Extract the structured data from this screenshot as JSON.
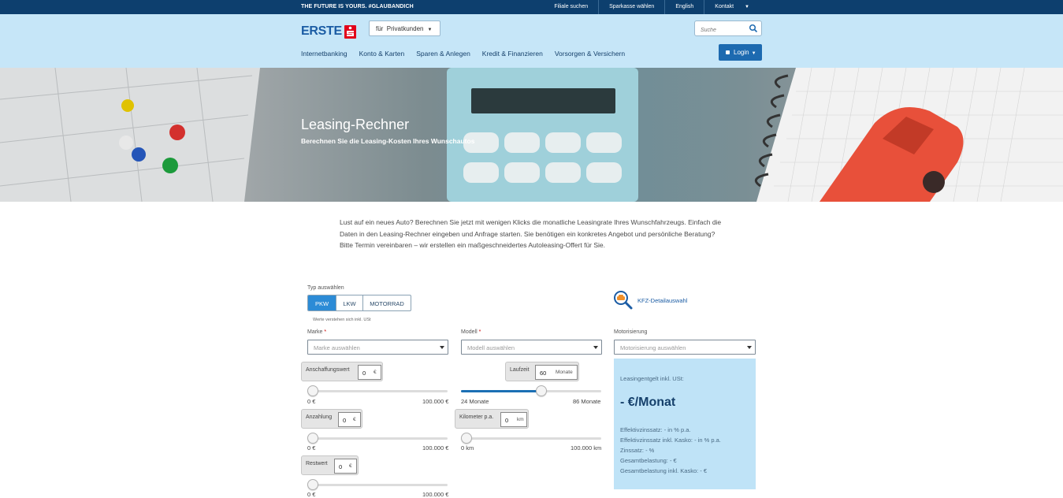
{
  "topbar": {
    "tagline": "THE FUTURE IS YOURS. #GLAUBANDICH",
    "links": [
      "Filiale suchen",
      "Sparkasse wählen",
      "English",
      "Kontakt"
    ]
  },
  "header": {
    "logo_text": "ERSTE",
    "segment_label": "für  Privatkunden",
    "search_placeholder": "Suche",
    "nav": [
      "Internetbanking",
      "Konto & Karten",
      "Sparen & Anlegen",
      "Kredit & Finanzieren",
      "Vorsorgen & Versichern"
    ],
    "login_label": "Login"
  },
  "hero": {
    "title": "Leasing-Rechner",
    "subtitle": "Berechnen Sie die Leasing-Kosten Ihres Wunschautos"
  },
  "intro": "Lust auf ein neues Auto? Berechnen Sie jetzt mit wenigen Klicks die monatliche Leasingrate Ihres Wunschfahrzeugs. Einfach die Daten in den Leasing-Rechner eingeben und Anfrage starten. Sie benötigen ein konkretes Angebot und persönliche Beratung? Bitte Termin vereinbaren – wir erstellen ein maßgeschneidertes Autoleasing-Offert für Sie.",
  "form": {
    "type_label": "Typ auswählen",
    "types": [
      "PKW",
      "LKW",
      "MOTORRAD"
    ],
    "active_type": "PKW",
    "note": "Werte verstehen sich inkl. USt",
    "kfz_link": "KFZ-Detailauswahl",
    "marke_label": "Marke",
    "marke_placeholder": "Marke auswählen",
    "modell_label": "Modell",
    "modell_placeholder": "Modell auswählen",
    "motor_label": "Motorisierung",
    "motor_placeholder": "Motorisierung auswählen",
    "required_mark": "*",
    "anschaffung": {
      "label": "Anschaffungswert",
      "value": "0",
      "unit": "€",
      "min": "0 €",
      "max": "100.000 €",
      "level": 0
    },
    "laufzeit": {
      "label": "Laufzeit",
      "value": "60",
      "unit": "Monate",
      "min": "24 Monate",
      "max": "86 Monate",
      "level": 0.58
    },
    "anzahlung": {
      "label": "Anzahlung",
      "value": "0",
      "unit": "€",
      "min": "0 €",
      "max": "100.000 €",
      "level": 0
    },
    "km": {
      "label": "Kilometer p.a.",
      "value": "0",
      "unit": "km",
      "min": "0 km",
      "max": "100.000 km",
      "level": 0
    },
    "restwert": {
      "label": "Restwert",
      "value": "0",
      "unit": "€",
      "min": "0 €",
      "max": "100.000 €",
      "level": 0
    }
  },
  "result": {
    "title": "Leasingentgelt inkl. USt:",
    "amount": "- €/Monat",
    "lines": [
      "Effektivzinssatz: - in % p.a.",
      "Effektivzinssatz inkl. Kasko: - in % p.a.",
      "Zinssatz: - %",
      "Gesamtbelastung: - €",
      "Gesamtbelastung inkl. Kasko: - €"
    ]
  },
  "colors": {
    "topbar": "#0d3f6e",
    "header": "#c6e6f8",
    "accent": "#1d6ab0",
    "result_box": "#bfe3f7"
  }
}
